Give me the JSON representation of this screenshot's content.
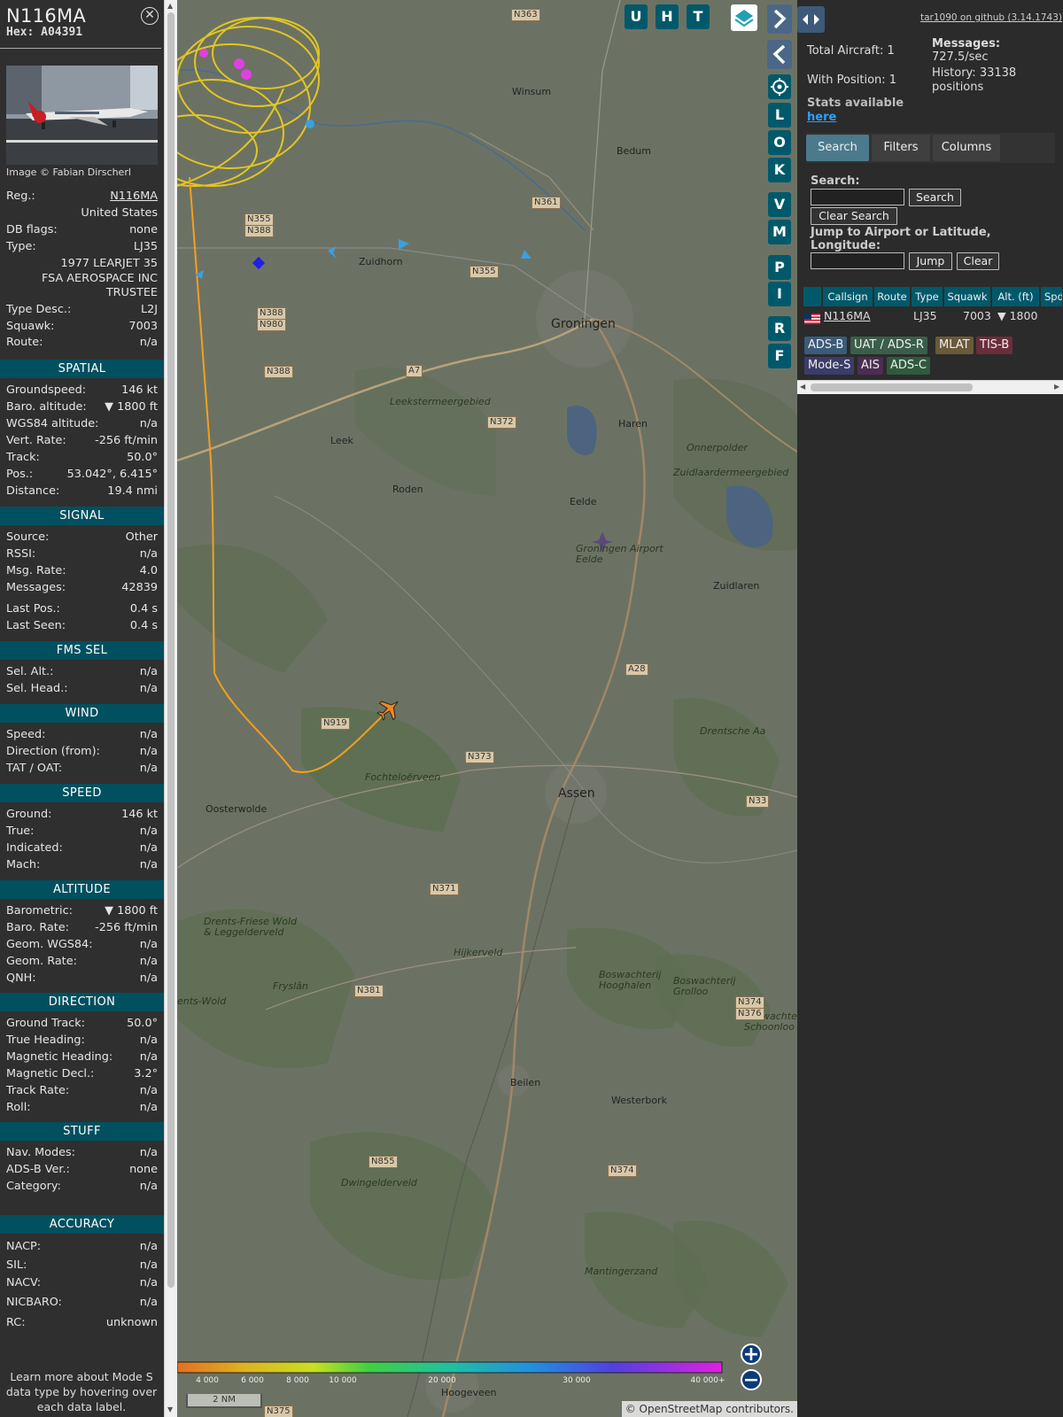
{
  "aircraft": {
    "callsign": "N116MA",
    "hex": "Hex: A04391",
    "photo_credit": "Image © Fabian Dirscherl",
    "close_symbol": "⊗"
  },
  "basic": [
    {
      "k": "Reg.:",
      "v": "N116MA"
    },
    {
      "k": "",
      "v": "United States"
    },
    {
      "k": "DB flags:",
      "v": "none"
    },
    {
      "k": "Type:",
      "v": "LJ35"
    },
    {
      "k": "",
      "v": "1977 LEARJET 35"
    },
    {
      "k": "",
      "v": "FSA AEROSPACE INC"
    },
    {
      "k": "",
      "v": "TRUSTEE"
    },
    {
      "k": "Type Desc.:",
      "v": "L2J"
    },
    {
      "k": "Squawk:",
      "v": "7003"
    },
    {
      "k": "Route:",
      "v": "n/a"
    }
  ],
  "sections": {
    "spatial": {
      "title": "SPATIAL",
      "rows": [
        {
          "k": "Groundspeed:",
          "v": "146 kt"
        },
        {
          "k": "Baro. altitude:",
          "v": "▼ 1800 ft"
        },
        {
          "k": "WGS84 altitude:",
          "v": "n/a"
        },
        {
          "k": "Vert. Rate:",
          "v": "-256 ft/min"
        },
        {
          "k": "Track:",
          "v": "50.0°"
        },
        {
          "k": "Pos.:",
          "v": "53.042°, 6.415°"
        },
        {
          "k": "Distance:",
          "v": "19.4 nmi"
        }
      ]
    },
    "signal": {
      "title": "SIGNAL",
      "rows": [
        {
          "k": "Source:",
          "v": "Other"
        },
        {
          "k": "RSSI:",
          "v": "n/a"
        },
        {
          "k": "Msg. Rate:",
          "v": "4.0"
        },
        {
          "k": "Messages:",
          "v": "42839"
        },
        {
          "k": "Last Pos.:",
          "v": "0.4 s"
        },
        {
          "k": "Last Seen:",
          "v": "0.4 s"
        }
      ]
    },
    "fms": {
      "title": "FMS SEL",
      "rows": [
        {
          "k": "Sel. Alt.:",
          "v": "n/a"
        },
        {
          "k": "Sel. Head.:",
          "v": "n/a"
        }
      ]
    },
    "wind": {
      "title": "WIND",
      "rows": [
        {
          "k": "Speed:",
          "v": "n/a"
        },
        {
          "k": "Direction (from):",
          "v": "n/a"
        },
        {
          "k": "TAT / OAT:",
          "v": "n/a"
        }
      ]
    },
    "speed": {
      "title": "SPEED",
      "rows": [
        {
          "k": "Ground:",
          "v": "146 kt"
        },
        {
          "k": "True:",
          "v": "n/a"
        },
        {
          "k": "Indicated:",
          "v": "n/a"
        },
        {
          "k": "Mach:",
          "v": "n/a"
        }
      ]
    },
    "altitude": {
      "title": "ALTITUDE",
      "rows": [
        {
          "k": "Barometric:",
          "v": "▼ 1800 ft"
        },
        {
          "k": "Baro. Rate:",
          "v": "-256 ft/min"
        },
        {
          "k": "Geom. WGS84:",
          "v": "n/a"
        },
        {
          "k": "Geom. Rate:",
          "v": "n/a"
        },
        {
          "k": "QNH:",
          "v": "n/a"
        }
      ]
    },
    "direction": {
      "title": "DIRECTION",
      "rows": [
        {
          "k": "Ground Track:",
          "v": "50.0°"
        },
        {
          "k": "True Heading:",
          "v": "n/a"
        },
        {
          "k": "Magnetic Heading:",
          "v": "n/a"
        },
        {
          "k": "Magnetic Decl.:",
          "v": "3.2°"
        },
        {
          "k": "Track Rate:",
          "v": "n/a"
        },
        {
          "k": "Roll:",
          "v": "n/a"
        }
      ]
    },
    "stuff": {
      "title": "STUFF",
      "rows": [
        {
          "k": "Nav. Modes:",
          "v": "n/a"
        },
        {
          "k": "ADS-B Ver.:",
          "v": "none"
        },
        {
          "k": "Category:",
          "v": "n/a"
        }
      ]
    },
    "accuracy": {
      "title": "ACCURACY",
      "rows": [
        {
          "k": "NACP:",
          "v": "n/a"
        },
        {
          "k": "SIL:",
          "v": "n/a"
        },
        {
          "k": "NACV:",
          "v": "n/a"
        },
        {
          "k": "NICBARO:",
          "v": "n/a"
        },
        {
          "k": "RC:",
          "v": "unknown"
        }
      ]
    }
  },
  "footer_note": "Learn more about Mode S data type by hovering over each data label.",
  "map": {
    "buttons_top": [
      "U",
      "H",
      "T"
    ],
    "buttons_side": [
      "L",
      "O",
      "K",
      "V",
      "M",
      "P",
      "I",
      "R",
      "F"
    ],
    "places": [
      "Winsum",
      "Bedum",
      "Zuidhorn",
      "Groningen",
      "Haren",
      "Leek",
      "Roden",
      "Eelde",
      "Groningen Airport Eelde",
      "Zuidlaren",
      "Onnerpolder",
      "Zuidlaardermeergebied",
      "Leekstermeergebied",
      "Drentsche Aa",
      "Fochteloërveen",
      "Assen",
      "Oosterwolde",
      "Drents-Friese Wold & Leggelderveld",
      "Hijkerveld",
      "Boswachterij Hooghalen",
      "Boswachterij Grolloo",
      "Boswachterij Schoonloo",
      "Beilen",
      "Westerbork",
      "Dwingelderveld",
      "Mantingerzand",
      "Hoogeveen",
      "Fryslân",
      "ents-Wold"
    ],
    "roads": [
      "N363",
      "N361",
      "N355",
      "N388",
      "N355",
      "N388",
      "N980",
      "N388",
      "A7",
      "N372",
      "N919",
      "N373",
      "N33",
      "N371",
      "N381",
      "N374",
      "N376",
      "N855",
      "N374",
      "A28",
      "N375"
    ],
    "colorbar_ticks": [
      "4 000",
      "6 000",
      "8 000",
      "10 000",
      "20 000",
      "30 000",
      "40 000+"
    ],
    "scale_label": "2 NM",
    "attribution": "© OpenStreetMap contributors."
  },
  "sidebar": {
    "github": "tar1090 on github (3.14.1743)",
    "total_aircraft": "Total Aircraft: 1",
    "with_position": "With Position: 1",
    "messages_label": "Messages:",
    "messages_value": "727.5/sec",
    "history_label": "History: 33138",
    "history_value": "positions",
    "stats_label": "Stats available",
    "stats_link": "here",
    "tabs": [
      "Search",
      "Filters",
      "Columns"
    ],
    "search_label": "Search:",
    "search_btn": "Search",
    "clear_search": "Clear Search",
    "jump_label": "Jump to Airport or Latitude, Longitude:",
    "jump_btn": "Jump",
    "clear_btn": "Clear",
    "columns": [
      "Callsign",
      "Route",
      "Type",
      "Squawk",
      "Alt. (ft)",
      "Spd"
    ],
    "row": {
      "callsign": "N116MA",
      "type": "LJ35",
      "squawk": "7003",
      "alt": "▼ 1800"
    },
    "legend": [
      {
        "label": "ADS-B",
        "color": "#3c5a7a"
      },
      {
        "label": "UAT / ADS-R",
        "color": "#3a5e4a"
      },
      {
        "label": "MLAT",
        "color": "#6a5a3a"
      },
      {
        "label": "TIS-B",
        "color": "#6a2e3a"
      },
      {
        "label": "Mode-S",
        "color": "#3c3c6a"
      },
      {
        "label": "AIS",
        "color": "#4a2e52"
      },
      {
        "label": "ADS-C",
        "color": "#2e5a3e"
      }
    ]
  }
}
